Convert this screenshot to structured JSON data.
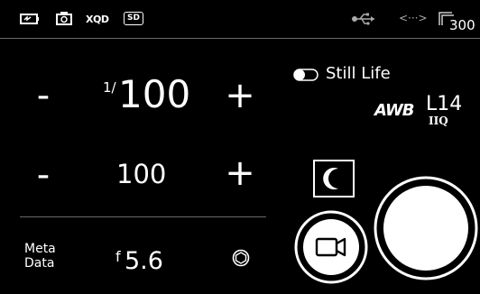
{
  "status_bar": {
    "icons": [
      "battery-icon",
      "camera-icon",
      "usb-icon",
      "link-icon",
      "frames-icon"
    ],
    "xqd_label": "XQD",
    "sd_label": "SD",
    "link_label": "<···>",
    "frames_count": "300"
  },
  "exposure": {
    "shutter_prefix": "1/",
    "shutter_value": "100",
    "iso_value": "100",
    "minus_label": "-",
    "plus_label": "+"
  },
  "bottom": {
    "meta_label_line1": "Meta",
    "meta_label_line2": "Data",
    "aperture_prefix": "f",
    "aperture_value": "5.6"
  },
  "right_panel": {
    "mode_label": "Still Life",
    "awb_label": "AWB",
    "profile_label": "L14",
    "profile_sub": "IIQ"
  },
  "colors": {
    "background": "#000000",
    "foreground": "#ffffff",
    "divider": "#6a6a6a"
  }
}
